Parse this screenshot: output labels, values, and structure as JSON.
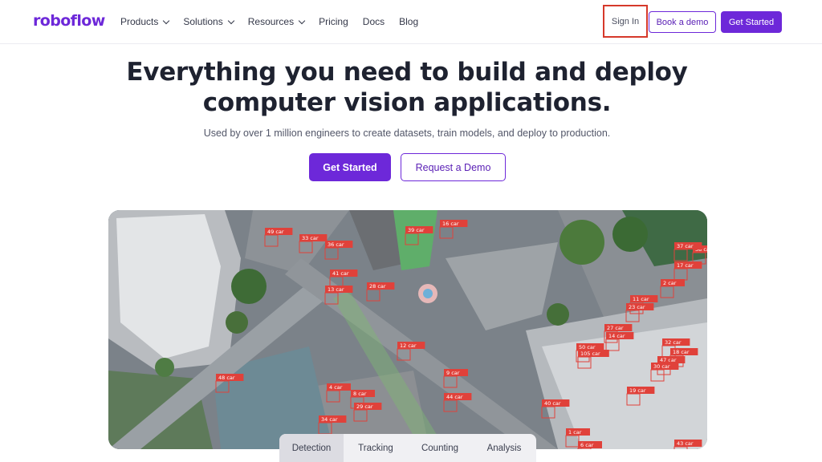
{
  "brand": {
    "logo": "roboflow",
    "accent": "#6d28d9"
  },
  "nav": {
    "items": [
      {
        "label": "Products",
        "dropdown": true
      },
      {
        "label": "Solutions",
        "dropdown": true
      },
      {
        "label": "Resources",
        "dropdown": true
      },
      {
        "label": "Pricing",
        "dropdown": false
      },
      {
        "label": "Docs",
        "dropdown": false
      },
      {
        "label": "Blog",
        "dropdown": false
      }
    ],
    "sign_in": "Sign In",
    "book_demo": "Book a demo",
    "get_started": "Get Started"
  },
  "hero": {
    "title_line1": "Everything you need to build and deploy",
    "title_line2": "computer vision applications.",
    "subtitle": "Used by over 1 million engineers to create datasets, train models, and deploy to production.",
    "cta_primary": "Get Started",
    "cta_secondary": "Request a Demo"
  },
  "media": {
    "labels": [
      "49 car",
      "33 car",
      "36 car",
      "41 car",
      "13 car",
      "28 car",
      "39 car",
      "16 car",
      "12 car",
      "9 car",
      "44 car",
      "4 car",
      "8 car",
      "29 car",
      "34 car",
      "48 car",
      "40 car",
      "17 car",
      "1 car",
      "6 car",
      "38 car",
      "37 car",
      "2 car",
      "11 car",
      "23 car",
      "27 car",
      "14 car",
      "50 car",
      "105 car",
      "47 car",
      "32 car",
      "18 car",
      "30 car",
      "19 car",
      "43 car"
    ]
  },
  "tabs": [
    {
      "label": "Detection",
      "active": true
    },
    {
      "label": "Tracking",
      "active": false
    },
    {
      "label": "Counting",
      "active": false
    },
    {
      "label": "Analysis",
      "active": false
    }
  ]
}
